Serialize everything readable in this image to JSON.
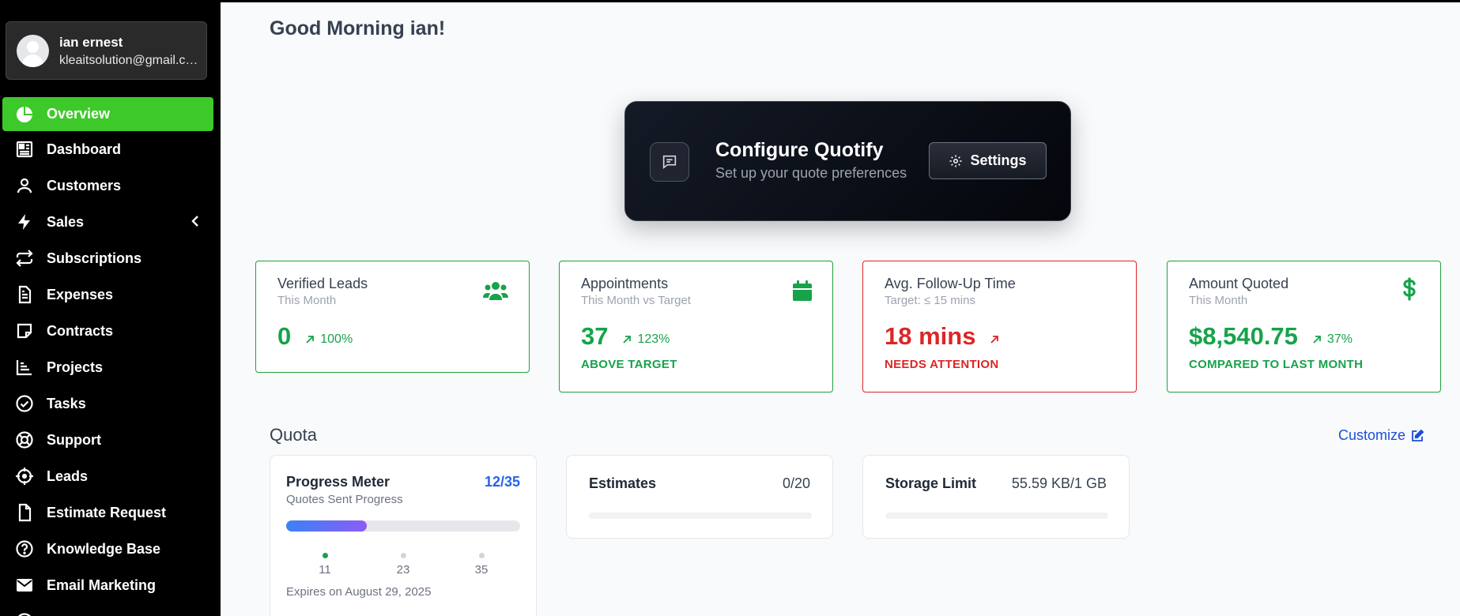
{
  "user": {
    "name": "ian ernest",
    "email": "kleaitsolution@gmail.com"
  },
  "sidebar": {
    "items": [
      {
        "label": "Overview",
        "icon": "pie-chart-icon",
        "active": true
      },
      {
        "label": "Dashboard",
        "icon": "dashboard-icon"
      },
      {
        "label": "Customers",
        "icon": "user-icon"
      },
      {
        "label": "Sales",
        "icon": "bolt-icon"
      },
      {
        "label": "Subscriptions",
        "icon": "repeat-icon"
      },
      {
        "label": "Expenses",
        "icon": "file-icon"
      },
      {
        "label": "Contracts",
        "icon": "sticky-note-icon"
      },
      {
        "label": "Projects",
        "icon": "bar-chart-icon"
      },
      {
        "label": "Tasks",
        "icon": "check-circle-icon"
      },
      {
        "label": "Support",
        "icon": "lifebuoy-icon"
      },
      {
        "label": "Leads",
        "icon": "crosshair-icon"
      },
      {
        "label": "Estimate Request",
        "icon": "document-icon"
      },
      {
        "label": "Knowledge Base",
        "icon": "help-circle-icon"
      },
      {
        "label": "Email Marketing",
        "icon": "envelope-icon"
      }
    ]
  },
  "greeting": "Good Morning ian!",
  "config": {
    "title": "Configure Quotify",
    "subtitle": "Set up your quote preferences",
    "button": "Settings"
  },
  "stats": [
    {
      "title": "Verified Leads",
      "subtitle": "This Month",
      "value": "0",
      "change": "100%",
      "note": "",
      "icon": "users-icon",
      "color": "#16a34a"
    },
    {
      "title": "Appointments",
      "subtitle": "This Month vs Target",
      "value": "37",
      "change": "123%",
      "note": "ABOVE TARGET",
      "icon": "calendar-icon",
      "color": "#16a34a"
    },
    {
      "title": "Avg. Follow-Up Time",
      "subtitle": "Target: ≤ 15 mins",
      "value": "18 mins",
      "change": "",
      "note": "NEEDS ATTENTION",
      "icon": "",
      "color": "#dc2626"
    },
    {
      "title": "Amount Quoted",
      "subtitle": "This Month",
      "value": "$8,540.75",
      "change": "37%",
      "note": "COMPARED TO LAST MONTH",
      "icon": "dollar-icon",
      "color": "#16a34a"
    }
  ],
  "quota": {
    "title": "Quota",
    "customize": "Customize",
    "progress": {
      "title": "Progress Meter",
      "count": "12/35",
      "subtitle": "Quotes Sent Progress",
      "fraction": 0.343,
      "ticks": [
        "11",
        "23",
        "35"
      ],
      "expires": "Expires on August 29, 2025"
    },
    "estimates": {
      "title": "Estimates",
      "value": "0/20",
      "fraction": 0
    },
    "storage": {
      "title": "Storage Limit",
      "value": "55.59 KB/1 GB",
      "fraction": 0
    }
  },
  "colors": {
    "accent": "#3ec92a",
    "positive": "#16a34a",
    "negative": "#dc2626",
    "link": "#1d4ed8"
  }
}
